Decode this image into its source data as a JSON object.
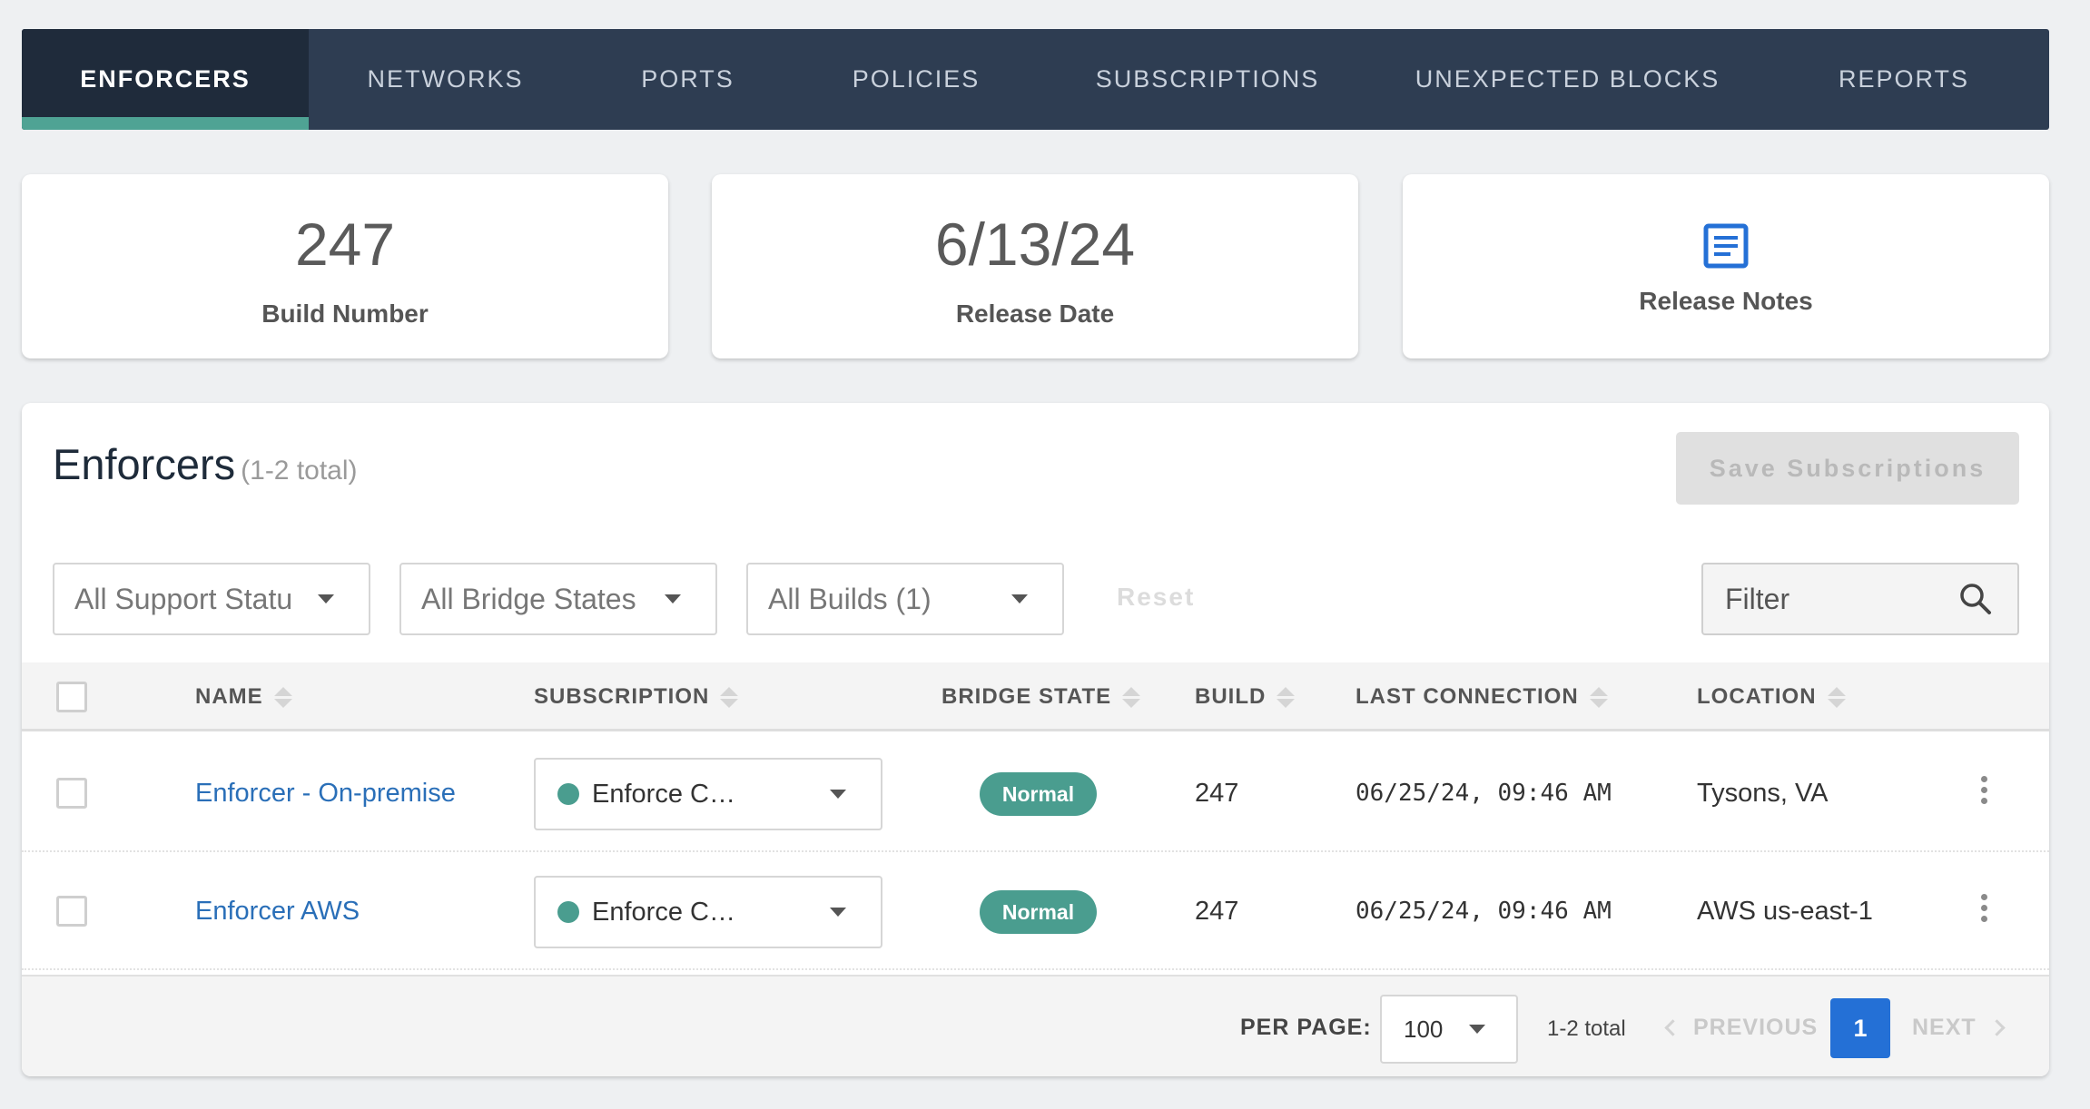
{
  "nav": {
    "tabs": [
      {
        "label": "ENFORCERS",
        "active": true
      },
      {
        "label": "NETWORKS",
        "active": false
      },
      {
        "label": "PORTS",
        "active": false
      },
      {
        "label": "POLICIES",
        "active": false
      },
      {
        "label": "SUBSCRIPTIONS",
        "active": false
      },
      {
        "label": "UNEXPECTED BLOCKS",
        "active": false
      },
      {
        "label": "REPORTS",
        "active": false
      }
    ]
  },
  "stats": {
    "build": {
      "value": "247",
      "label": "Build Number"
    },
    "release": {
      "value": "6/13/24",
      "label": "Release Date"
    },
    "notes": {
      "label": "Release Notes",
      "icon": "document-icon"
    }
  },
  "panel": {
    "title": "Enforcers",
    "total": "(1-2 total)",
    "save_label": "Save Subscriptions"
  },
  "filters": {
    "support": "All Support Statu",
    "bridge": "All Bridge States",
    "builds": "All Builds (1)",
    "reset": "Reset",
    "filter_placeholder": "Filter"
  },
  "table": {
    "columns": {
      "name": "NAME",
      "subscription": "SUBSCRIPTION",
      "bridge_state": "BRIDGE STATE",
      "build": "BUILD",
      "last_connection": "LAST CONNECTION",
      "location": "LOCATION"
    },
    "rows": [
      {
        "name": "Enforcer - On-premise",
        "subscription": "Enforce C…",
        "bridge_state": "Normal",
        "build": "247",
        "last_connection": "06/25/24, 09:46 AM",
        "location": "Tysons, VA"
      },
      {
        "name": "Enforcer AWS",
        "subscription": "Enforce C…",
        "bridge_state": "Normal",
        "build": "247",
        "last_connection": "06/25/24, 09:46 AM",
        "location": "AWS us-east-1"
      }
    ]
  },
  "pagination": {
    "per_page_label": "PER PAGE:",
    "per_page_value": "100",
    "total": "1-2 total",
    "previous": "PREVIOUS",
    "current_page": "1",
    "next": "NEXT"
  },
  "colors": {
    "nav_bg": "#2e3d52",
    "active_tab_bg": "#1f2b3b",
    "accent_teal": "#4fa394",
    "link_blue": "#2a6fb8",
    "primary_blue": "#2470d6"
  }
}
